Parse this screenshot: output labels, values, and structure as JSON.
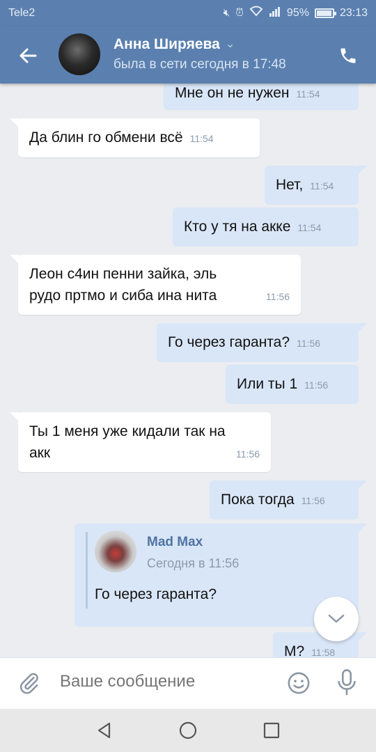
{
  "status_bar": {
    "carrier": "Tele2",
    "battery": "95%",
    "battery_level": 0.95,
    "time": "23:13"
  },
  "header": {
    "name": "Анна Ширяева",
    "status": "была в сети сегодня в 17:48"
  },
  "messages": [
    {
      "text": "Мне он не нужен",
      "time": "11:54",
      "direction": "out"
    },
    {
      "text": "Да блин го обмени всё",
      "time": "11:54",
      "direction": "in"
    },
    {
      "text": "Нет,",
      "time": "11:54",
      "direction": "out"
    },
    {
      "text": "Кто у тя на акке",
      "time": "11:54",
      "direction": "out"
    },
    {
      "text": "Леон с4ин пенни зайка, эль рудо пртмо и сиба ина нита",
      "time": "11:56",
      "direction": "in"
    },
    {
      "text": "Го через гаранта?",
      "time": "11:56",
      "direction": "out"
    },
    {
      "text": "Или ты 1",
      "time": "11:56",
      "direction": "out"
    },
    {
      "text": "Ты 1 меня уже кидали так на акк",
      "time": "11:56",
      "direction": "in"
    },
    {
      "text": "Пока тогда",
      "time": "11:56",
      "direction": "out"
    },
    {
      "text": "М?",
      "time": "11:58",
      "direction": "out"
    }
  ],
  "forwarded": {
    "author": "Mad Max",
    "date": "Сегодня в 11:56",
    "text": "Го через гаранта?"
  },
  "composer": {
    "placeholder": "Ваше сообщение"
  },
  "colors": {
    "header": "#5b80b0",
    "outgoing_bubble": "#d9e6f7",
    "incoming_bubble": "#ffffff",
    "background": "#ebedf0"
  }
}
